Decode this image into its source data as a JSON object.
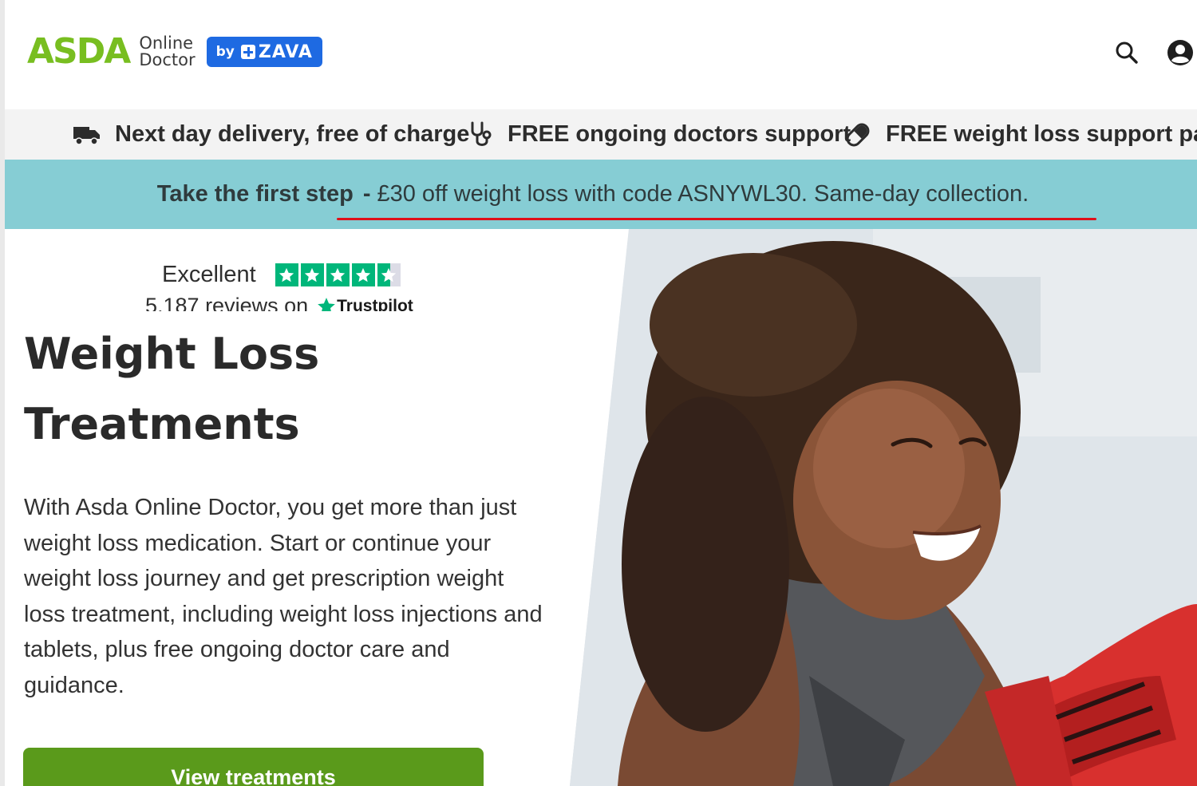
{
  "header": {
    "logo": {
      "brand": "ASDA",
      "line1": "Online",
      "line2": "Doctor",
      "badge_by": "by",
      "badge_name": "ZAVA"
    },
    "icons": [
      "search-icon",
      "account-icon"
    ]
  },
  "usp": [
    {
      "icon": "truck-icon",
      "text": "Next day delivery, free of charge"
    },
    {
      "icon": "stethoscope-icon",
      "text": "FREE ongoing doctors support"
    },
    {
      "icon": "pill-icon",
      "text": "FREE weight loss support pack"
    }
  ],
  "promo": {
    "strong": "Take the first step",
    "separator": "-",
    "text": "£30 off weight loss with code ASNYWL30. Same-day collection."
  },
  "rating": {
    "label": "Excellent",
    "reviews": "5,187 reviews on",
    "provider": "Trustpilot",
    "stars": 4.5
  },
  "hero": {
    "title_line1": "Weight Loss",
    "title_line2": "Treatments",
    "description": "With Asda Online Doctor, you get more than just weight loss medication. Start or continue your weight loss journey and get prescription weight loss treatment, including weight loss injections and tablets, plus free ongoing doctor care and guidance.",
    "cta": "View treatments"
  },
  "colors": {
    "brand_green": "#78be20",
    "zava_blue": "#1e6ae2",
    "promo_bg": "#86cdd4",
    "cta_green": "#5a9a1b",
    "trustpilot_green": "#00b67a",
    "underline_red": "#e0101a"
  }
}
